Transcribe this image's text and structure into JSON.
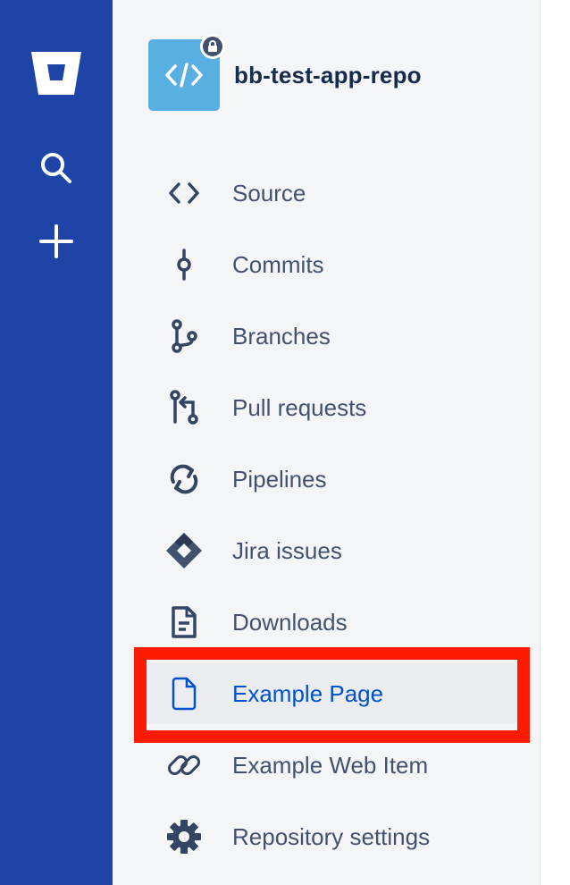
{
  "global_nav": {
    "logo_icon": "bitbucket-logo-icon",
    "search_icon": "search-icon",
    "create_icon": "plus-icon"
  },
  "repo": {
    "name": "bb-test-app-repo",
    "avatar_icon": "code-icon",
    "badge_icon": "lock-icon"
  },
  "nav": {
    "items": [
      {
        "label": "Source",
        "icon": "source-code-icon"
      },
      {
        "label": "Commits",
        "icon": "commit-icon"
      },
      {
        "label": "Branches",
        "icon": "branch-icon"
      },
      {
        "label": "Pull requests",
        "icon": "pull-request-icon"
      },
      {
        "label": "Pipelines",
        "icon": "pipelines-icon"
      },
      {
        "label": "Jira issues",
        "icon": "jira-icon"
      },
      {
        "label": "Downloads",
        "icon": "document-icon"
      },
      {
        "label": "Example Page",
        "icon": "page-icon",
        "selected": true
      },
      {
        "label": "Example Web Item",
        "icon": "link-icon"
      },
      {
        "label": "Repository settings",
        "icon": "gear-icon"
      }
    ]
  },
  "colors": {
    "global_nav_bg": "#1f44a8",
    "sidebar_bg": "#f4f5f7",
    "selected_text": "#0052cc",
    "highlight_border": "#ff1a00"
  }
}
